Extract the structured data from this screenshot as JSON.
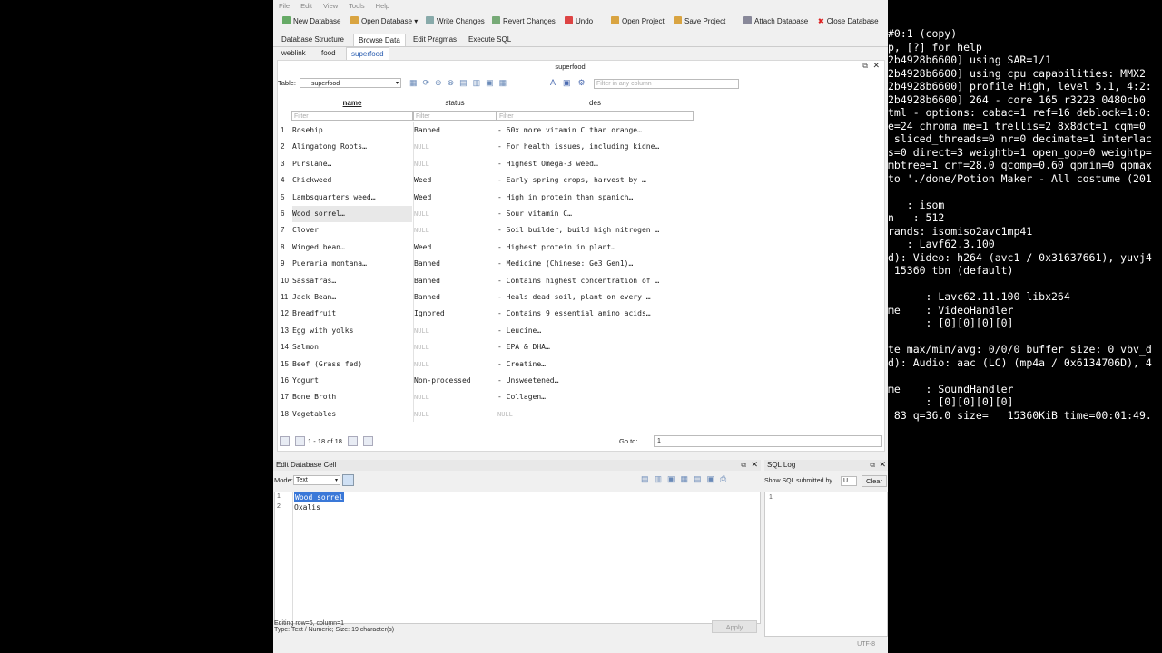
{
  "menu": [
    "File",
    "Edit",
    "View",
    "Tools",
    "Help"
  ],
  "toolbar": {
    "new_database": "New Database",
    "open_database": "Open Database",
    "write_changes": "Write Changes",
    "revert_changes": "Revert Changes",
    "undo": "Undo",
    "open_project": "Open Project",
    "save_project": "Save Project",
    "attach_database": "Attach Database",
    "close_database": "Close Database"
  },
  "main_tabs": [
    "Database Structure",
    "Browse Data",
    "Edit Pragmas",
    "Execute SQL"
  ],
  "table_tabs": [
    "weblink",
    "food",
    "superfood"
  ],
  "panel": {
    "title": "superfood",
    "table_label": "Table:",
    "table_value": "superfood",
    "filter_any_placeholder": "Filter in any column"
  },
  "columns": [
    "name",
    "status",
    "des"
  ],
  "filter_placeholder": "Filter",
  "rows": [
    {
      "n": "1",
      "name": "Rosehip",
      "status": "Banned",
      "des": "- 60x more vitamin C than orange…"
    },
    {
      "n": "2",
      "name": "Alingatong Roots…",
      "status": "NULL",
      "des": "- For health issues, including kidne…"
    },
    {
      "n": "3",
      "name": "Purslane…",
      "status": "NULL",
      "des": "- Highest Omega-3 weed…"
    },
    {
      "n": "4",
      "name": "Chickweed",
      "status": "Weed",
      "des": "- Early spring crops, harvest by …"
    },
    {
      "n": "5",
      "name": "Lambsquarters weed…",
      "status": "Weed",
      "des": "- High in protein than spanich…"
    },
    {
      "n": "6",
      "name": "Wood sorrel…",
      "status": "NULL",
      "des": "- Sour vitamin C…"
    },
    {
      "n": "7",
      "name": "Clover",
      "status": "NULL",
      "des": "- Soil builder, build high nitrogen …"
    },
    {
      "n": "8",
      "name": "Winged bean…",
      "status": "Weed",
      "des": "- Highest protein in plant…"
    },
    {
      "n": "9",
      "name": "Pueraria montana…",
      "status": "Banned",
      "des": "- Medicine (Chinese: Ge3 Gen1)…"
    },
    {
      "n": "10",
      "name": "Sassafras…",
      "status": "Banned",
      "des": "- Contains highest concentration of …"
    },
    {
      "n": "11",
      "name": "Jack Bean…",
      "status": "Banned",
      "des": "- Heals dead soil, plant on every …"
    },
    {
      "n": "12",
      "name": "Breadfruit",
      "status": "Ignored",
      "des": "- Contains 9 essential amino acids…"
    },
    {
      "n": "13",
      "name": "Egg with yolks",
      "status": "NULL",
      "des": "- Leucine…"
    },
    {
      "n": "14",
      "name": "Salmon",
      "status": "NULL",
      "des": "- EPA & DHA…"
    },
    {
      "n": "15",
      "name": "Beef (Grass fed)",
      "status": "NULL",
      "des": "- Creatine…"
    },
    {
      "n": "16",
      "name": "Yogurt",
      "status": "Non-processed",
      "des": "- Unsweetened…"
    },
    {
      "n": "17",
      "name": "Bone Broth",
      "status": "NULL",
      "des": "- Collagen…"
    },
    {
      "n": "18",
      "name": "Vegetables",
      "status": "NULL",
      "des": "NULL"
    }
  ],
  "nav": {
    "record_count": "1 - 18 of 18",
    "goto_label": "Go to:",
    "goto_value": "1"
  },
  "edit_cell": {
    "title": "Edit Database Cell",
    "mode_label": "Mode:",
    "mode_value": "Text",
    "line1_num": "1",
    "line1": "Wood sorrel",
    "line2_num": "2",
    "line2": "Oxalis",
    "status1": "Editing row=6, column=1",
    "status2": "Type: Text / Numeric; Size: 19 character(s)",
    "apply": "Apply"
  },
  "sql_log": {
    "title": "SQL Log",
    "show_label": "Show SQL submitted by",
    "show_value": "U",
    "clear": "Clear",
    "line_num": "1"
  },
  "statusbar": {
    "encoding": "UTF-8"
  },
  "terminal": [
    "#0:1 (copy)",
    "p, [?] for help",
    "2b4928b6600] using SAR=1/1",
    "2b4928b6600] using cpu capabilities: MMX2",
    "2b4928b6600] profile High, level 5.1, 4:2:",
    "2b4928b6600] 264 - core 165 r3223 0480cb0",
    "tml - options: cabac=1 ref=16 deblock=1:0:",
    "e=24 chroma_me=1 trellis=2 8x8dct=1 cqm=0",
    " sliced_threads=0 nr=0 decimate=1 interlac",
    "s=0 direct=3 weightb=1 open_gop=0 weightp=",
    "mbtree=1 crf=28.0 qcomp=0.60 qpmin=0 qpmax",
    "to './done/Potion Maker - All costume (201",
    "",
    "   : isom",
    "n   : 512",
    "rands: isomiso2avc1mp41",
    "   : Lavf62.3.100",
    "d): Video: h264 (avc1 / 0x31637661), yuvj4",
    " 15360 tbn (default)",
    "",
    "      : Lavc62.11.100 libx264",
    "me    : VideoHandler",
    "      : [0][0][0][0]",
    "",
    "te max/min/avg: 0/0/0 buffer size: 0 vbv_d",
    "d): Audio: aac (LC) (mp4a / 0x6134706D), 4",
    "",
    "me    : SoundHandler",
    "      : [0][0][0][0]",
    " 83 q=36.0 size=   15360KiB time=00:01:49."
  ],
  "colors": {
    "accent": "#3a78d8",
    "null_text": "#bbbbbb",
    "terminal_bg": "#000000",
    "terminal_fg": "#ffffff"
  }
}
